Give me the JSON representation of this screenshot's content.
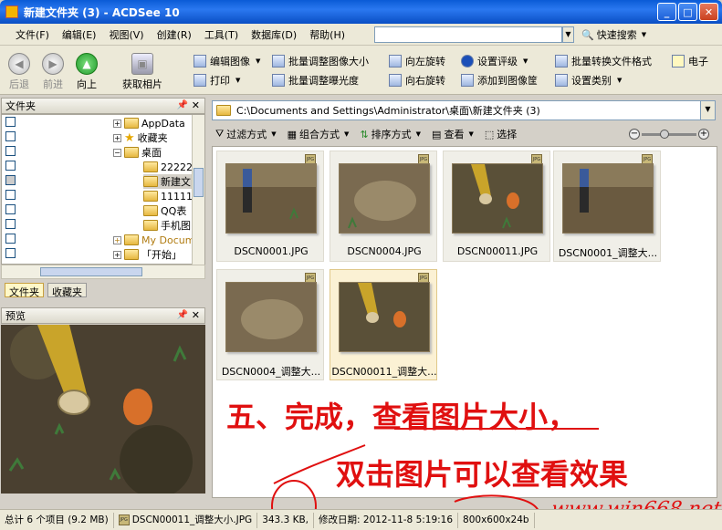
{
  "window": {
    "title": "新建文件夹 (3) - ACDSee 10"
  },
  "menu": [
    "文件(F)",
    "编辑(E)",
    "视图(V)",
    "创建(R)",
    "工具(T)",
    "数据库(D)",
    "帮助(H)"
  ],
  "search": {
    "value": "",
    "quick_label": "快速搜索"
  },
  "nav": {
    "back": "后退",
    "forward": "前进",
    "up": "向上",
    "acquire": "获取相片"
  },
  "toolbar": {
    "edit_image": "编辑图像",
    "batch_resize": "批量调整图像大小",
    "rotate_left": "向左旋转",
    "set_rating": "设置评级",
    "batch_convert": "批量转换文件格式",
    "email": "电子",
    "print": "打印",
    "batch_exposure": "批量调整曝光度",
    "rotate_right": "向右旋转",
    "add_to_basket": "添加到图像筐",
    "set_category": "设置类别"
  },
  "folders_panel": {
    "title": "文件夹",
    "items": [
      "AppData",
      "收藏夹",
      "桌面",
      "22222",
      "新建文",
      "11111",
      "QQ表",
      "手机图",
      "My Docum",
      "「开始」"
    ],
    "tabs": [
      "文件夹",
      "收藏夹"
    ]
  },
  "preview_panel": {
    "title": "预览"
  },
  "path": "C:\\Documents and Settings\\Administrator\\桌面\\新建文件夹 (3)",
  "filterbar": {
    "filter": "过滤方式",
    "group": "组合方式",
    "sort": "排序方式",
    "view": "查看",
    "select": "选择"
  },
  "thumbnails": [
    {
      "name": "DSCN0001.JPG",
      "badge": "JPG"
    },
    {
      "name": "DSCN0004.JPG",
      "badge": "JPG"
    },
    {
      "name": "DSCN00011.JPG",
      "badge": "JPG"
    },
    {
      "name": "DSCN0001_调整大...",
      "badge": "JPG"
    },
    {
      "name": "DSCN0004_调整大...",
      "badge": "JPG"
    },
    {
      "name": "DSCN00011_调整大...",
      "badge": "JPG"
    }
  ],
  "annotation": {
    "line1": "五、完成，查看图片大小，",
    "line2": "双击图片可以查看效果",
    "watermark": "www.win668.net"
  },
  "status": {
    "total": "总计 6 个项目 (9.2 MB)",
    "file": "DSCN00011_调整大小.JPG",
    "size": "343.3 KB,",
    "modified": "修改日期: 2012-11-8 5:19:16",
    "dims": "800x600x24b"
  },
  "colors": {
    "title_bar": "#0a5bd6",
    "annotation": "#e01010"
  }
}
